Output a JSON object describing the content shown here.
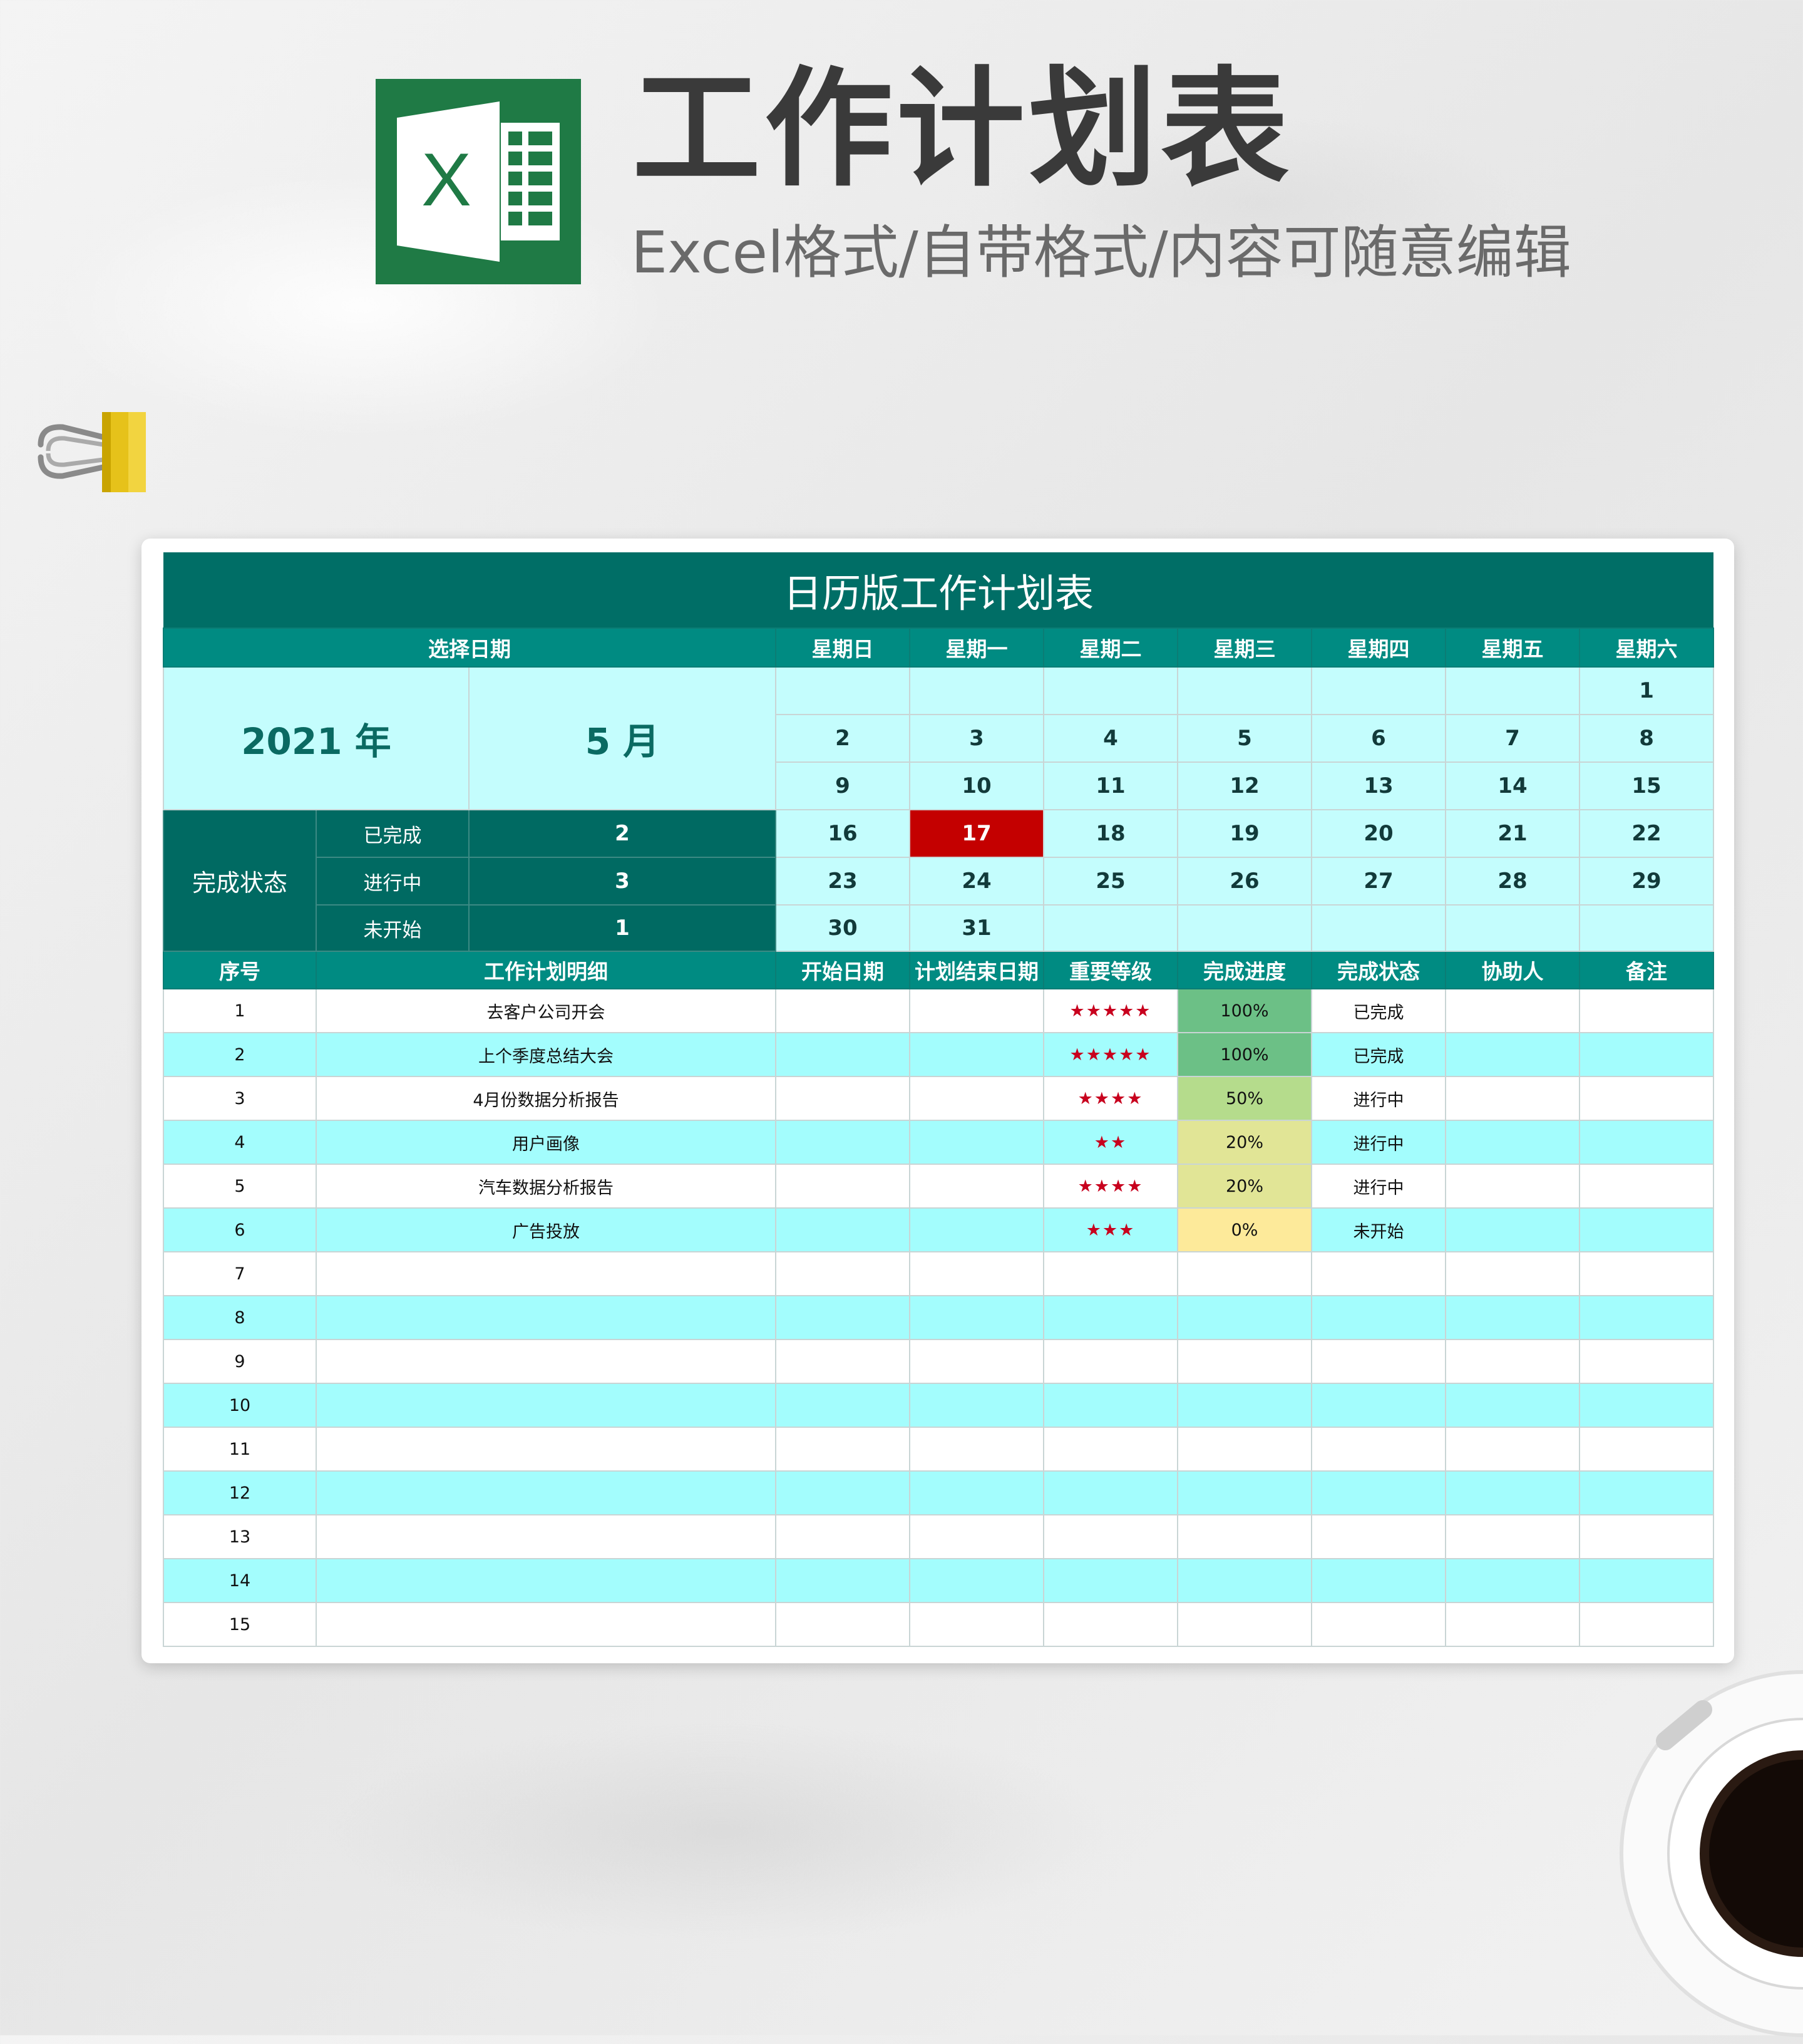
{
  "header": {
    "title": "工作计划表",
    "subtitle": "Excel格式/自带格式/内容可随意编辑",
    "logo_letter": "X",
    "logo_color": "#1f7a45"
  },
  "sheet": {
    "title": "日历版工作计划表",
    "select_date_label": "选择日期",
    "weekdays": [
      "星期日",
      "星期一",
      "星期二",
      "星期三",
      "星期四",
      "星期五",
      "星期六"
    ],
    "year_label": "2021 年",
    "month_label": "5 月",
    "calendar_rows": [
      [
        "",
        "",
        "",
        "",
        "",
        "",
        "1"
      ],
      [
        "2",
        "3",
        "4",
        "5",
        "6",
        "7",
        "8"
      ],
      [
        "9",
        "10",
        "11",
        "12",
        "13",
        "14",
        "15"
      ],
      [
        "16",
        "17",
        "18",
        "19",
        "20",
        "21",
        "22"
      ],
      [
        "23",
        "24",
        "25",
        "26",
        "27",
        "28",
        "29"
      ],
      [
        "30",
        "31",
        "",
        "",
        "",
        "",
        ""
      ]
    ],
    "highlight_day": "17",
    "status": {
      "group_label": "完成状态",
      "items": [
        {
          "label": "已完成",
          "count": "2"
        },
        {
          "label": "进行中",
          "count": "3"
        },
        {
          "label": "未开始",
          "count": "1"
        }
      ]
    },
    "columns": [
      "序号",
      "工作计划明细",
      "开始日期",
      "计划结束日期",
      "重要等级",
      "完成进度",
      "完成状态",
      "协助人",
      "备注"
    ],
    "rows": [
      {
        "no": "1",
        "task": "去客户公司开会",
        "start": "",
        "end": "",
        "stars": "★★★★★",
        "progress": "100%",
        "status": "已完成",
        "helper": "",
        "note": ""
      },
      {
        "no": "2",
        "task": "上个季度总结大会",
        "start": "",
        "end": "",
        "stars": "★★★★★",
        "progress": "100%",
        "status": "已完成",
        "helper": "",
        "note": ""
      },
      {
        "no": "3",
        "task": "4月份数据分析报告",
        "start": "",
        "end": "",
        "stars": "★★★★",
        "progress": "50%",
        "status": "进行中",
        "helper": "",
        "note": ""
      },
      {
        "no": "4",
        "task": "用户画像",
        "start": "",
        "end": "",
        "stars": "★★",
        "progress": "20%",
        "status": "进行中",
        "helper": "",
        "note": ""
      },
      {
        "no": "5",
        "task": "汽车数据分析报告",
        "start": "",
        "end": "",
        "stars": "★★★★",
        "progress": "20%",
        "status": "进行中",
        "helper": "",
        "note": ""
      },
      {
        "no": "6",
        "task": "广告投放",
        "start": "",
        "end": "",
        "stars": "★★★",
        "progress": "0%",
        "status": "未开始",
        "helper": "",
        "note": ""
      },
      {
        "no": "7",
        "task": "",
        "start": "",
        "end": "",
        "stars": "",
        "progress": "",
        "status": "",
        "helper": "",
        "note": ""
      },
      {
        "no": "8",
        "task": "",
        "start": "",
        "end": "",
        "stars": "",
        "progress": "",
        "status": "",
        "helper": "",
        "note": ""
      },
      {
        "no": "9",
        "task": "",
        "start": "",
        "end": "",
        "stars": "",
        "progress": "",
        "status": "",
        "helper": "",
        "note": ""
      },
      {
        "no": "10",
        "task": "",
        "start": "",
        "end": "",
        "stars": "",
        "progress": "",
        "status": "",
        "helper": "",
        "note": ""
      },
      {
        "no": "11",
        "task": "",
        "start": "",
        "end": "",
        "stars": "",
        "progress": "",
        "status": "",
        "helper": "",
        "note": ""
      },
      {
        "no": "12",
        "task": "",
        "start": "",
        "end": "",
        "stars": "",
        "progress": "",
        "status": "",
        "helper": "",
        "note": ""
      },
      {
        "no": "13",
        "task": "",
        "start": "",
        "end": "",
        "stars": "",
        "progress": "",
        "status": "",
        "helper": "",
        "note": ""
      },
      {
        "no": "14",
        "task": "",
        "start": "",
        "end": "",
        "stars": "",
        "progress": "",
        "status": "",
        "helper": "",
        "note": ""
      },
      {
        "no": "15",
        "task": "",
        "start": "",
        "end": "",
        "stars": "",
        "progress": "",
        "status": "",
        "helper": "",
        "note": ""
      }
    ],
    "progress_colors": {
      "100%": "#6cc086",
      "50%": "#b5dc8c",
      "20%": "#e1e596",
      "0%": "#fdea9a"
    }
  }
}
